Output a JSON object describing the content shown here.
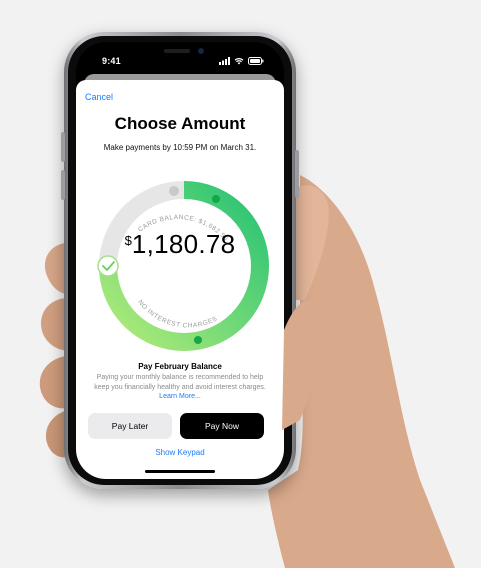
{
  "status_bar": {
    "time": "9:41"
  },
  "header": {
    "cancel_label": "Cancel",
    "title": "Choose Amount",
    "subtitle": "Make payments by 10:59 PM on March 31."
  },
  "dial": {
    "currency_symbol": "$",
    "amount_value": "1,180.78",
    "card_balance_label": "CARD BALANCE: $1,682.55",
    "no_interest_label": "NO INTEREST CHARGES",
    "colors": {
      "track": "#e6e6e6",
      "green_start": "#b5ec7a",
      "green_end": "#25c274",
      "marker": "#16a64a"
    }
  },
  "payment_info": {
    "title": "Pay February Balance",
    "description": "Paying your monthly balance is recommended to help keep you financially healthy and avoid interest charges.",
    "learn_more_label": "Learn More..."
  },
  "actions": {
    "pay_later_label": "Pay Later",
    "pay_now_label": "Pay Now",
    "show_keypad_label": "Show Keypad"
  },
  "colors": {
    "accent_blue": "#1a7cf5",
    "background": "#f2f2f2"
  },
  "icons": {
    "checkmark": "checkmark-icon",
    "signal": "signal-icon",
    "wifi": "wifi-icon",
    "battery": "battery-icon"
  }
}
